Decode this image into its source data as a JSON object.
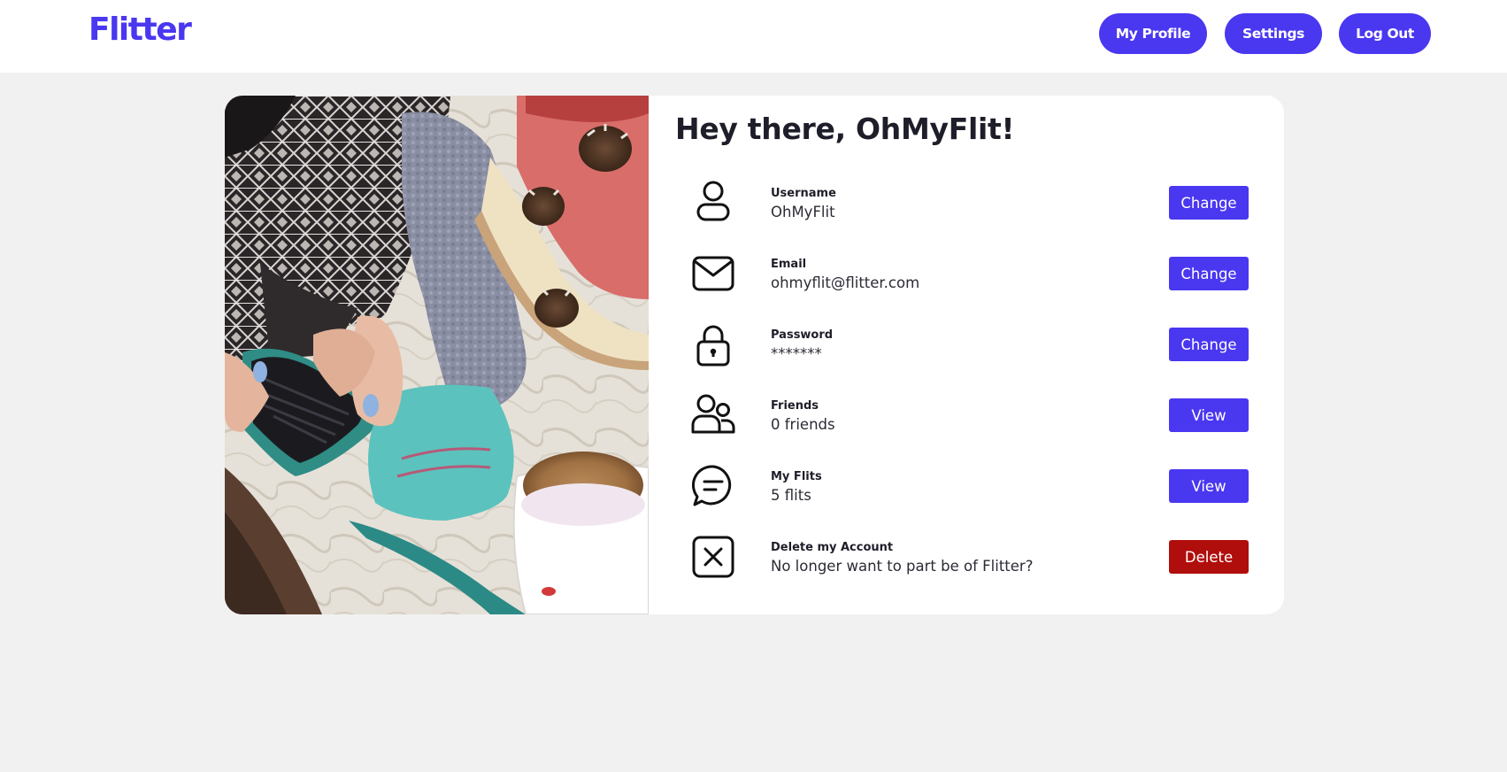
{
  "app": {
    "logo": "Flitter",
    "brand_color": "#4a37f0",
    "danger_color": "#b00d0d"
  },
  "nav": {
    "my_profile": "My Profile",
    "settings": "Settings",
    "log_out": "Log Out"
  },
  "profile": {
    "greeting": "Hey there, OhMyFlit!",
    "photo_icon": "lifestyle-photo-phone-coffee",
    "rows": [
      {
        "icon": "user-icon",
        "label": "Username",
        "value": "OhMyFlit",
        "action": "Change"
      },
      {
        "icon": "mail-icon",
        "label": "Email",
        "value": "ohmyflit@flitter.com",
        "action": "Change"
      },
      {
        "icon": "lock-icon",
        "label": "Password",
        "value": "*******",
        "action": "Change"
      },
      {
        "icon": "friends-icon",
        "label": "Friends",
        "value": "0 friends",
        "action": "View"
      },
      {
        "icon": "chat-bubble-icon",
        "label": "My Flits",
        "value": "5 flits",
        "action": "View"
      },
      {
        "icon": "close-box-icon",
        "label": "Delete my Account",
        "value": "No longer want to part be of Flitter?",
        "action": "Delete"
      }
    ]
  }
}
